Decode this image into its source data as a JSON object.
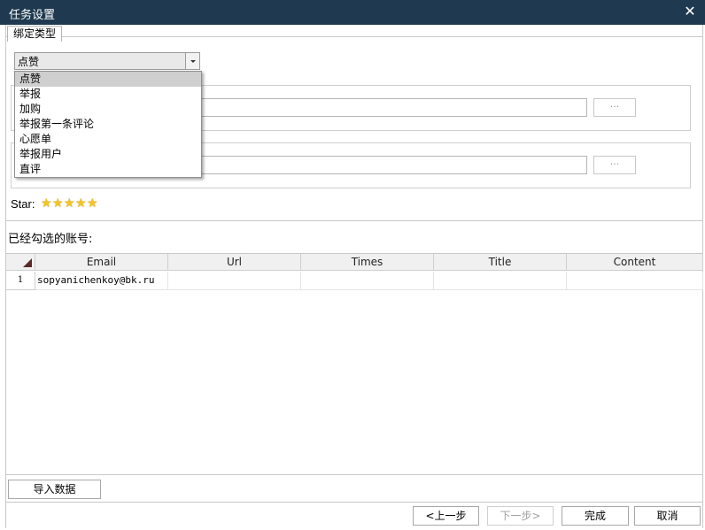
{
  "window": {
    "title": "任务设置",
    "close_symbol": "✕"
  },
  "tab": {
    "label": "绑定类型"
  },
  "bind_type": {
    "selected": "点赞",
    "options": [
      "点赞",
      "举报",
      "加购",
      "举报第一条评论",
      "心愿单",
      "举报用户",
      "直评"
    ]
  },
  "browse_buttons": [
    "···",
    "···"
  ],
  "star": {
    "label": "Star:",
    "rating": 5,
    "max": 5,
    "color": "#f5c623"
  },
  "accounts": {
    "label": "已经勾选的账号:",
    "columns": [
      "Email",
      "Url",
      "Times",
      "Title",
      "Content"
    ],
    "rows": [
      {
        "num": "1",
        "cells": [
          "sopyanichenkoy@bk.ru",
          "",
          "",
          "",
          ""
        ]
      }
    ]
  },
  "buttons": {
    "import": "导入数据",
    "prev": "<上一步",
    "next": "下一步>",
    "finish": "完成",
    "cancel": "取消"
  },
  "colors": {
    "titlebar": "#1f3a50"
  }
}
